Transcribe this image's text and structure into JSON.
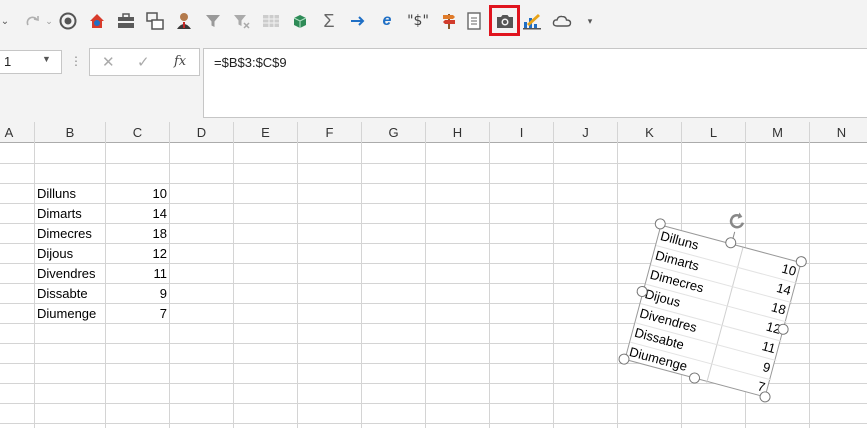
{
  "toolbar": {
    "items": [
      "chevron-down-icon",
      "redo-icon",
      "redo-dropdown-icon",
      "circle-record-icon",
      "home-shield-icon",
      "toolbox-icon",
      "copy-windows-icon",
      "user-icon",
      "filter-icon",
      "clear-filter-icon",
      "table-icon",
      "cube-icon",
      "sigma-icon",
      "arrow-right-icon",
      "ie-icon",
      "currency-icon",
      "signpost-icon",
      "document-icon",
      "camera-icon",
      "chart-pencil-icon",
      "cloud-icon",
      "customize-icon"
    ],
    "currency_label": "\"$\"",
    "highlight_color": "#e0141e"
  },
  "formula_bar": {
    "name_box": "1",
    "cancel": "✕",
    "enter": "✓",
    "fx": "fx",
    "formula": "=$B$3:$C$9"
  },
  "columns": [
    "A",
    "B",
    "C",
    "D",
    "E",
    "F",
    "G",
    "H",
    "I",
    "J",
    "K",
    "L",
    "M",
    "N"
  ],
  "table": {
    "rows": [
      {
        "day": "Dilluns",
        "value": "10"
      },
      {
        "day": "Dimarts",
        "value": "14"
      },
      {
        "day": "Dimecres",
        "value": "18"
      },
      {
        "day": "Dijous",
        "value": "12"
      },
      {
        "day": "Divendres",
        "value": "11"
      },
      {
        "day": "Dissabte",
        "value": "9"
      },
      {
        "day": "Diumenge",
        "value": "7"
      }
    ]
  },
  "picture": {
    "rows": [
      {
        "day": "Dilluns",
        "value": "10"
      },
      {
        "day": "Dimarts",
        "value": "14"
      },
      {
        "day": "Dimecres",
        "value": "18"
      },
      {
        "day": "Dijous",
        "value": "12"
      },
      {
        "day": "Divendres",
        "value": "11"
      },
      {
        "day": "Dissabte",
        "value": "9"
      },
      {
        "day": "Diumenge",
        "value": "7"
      }
    ]
  }
}
